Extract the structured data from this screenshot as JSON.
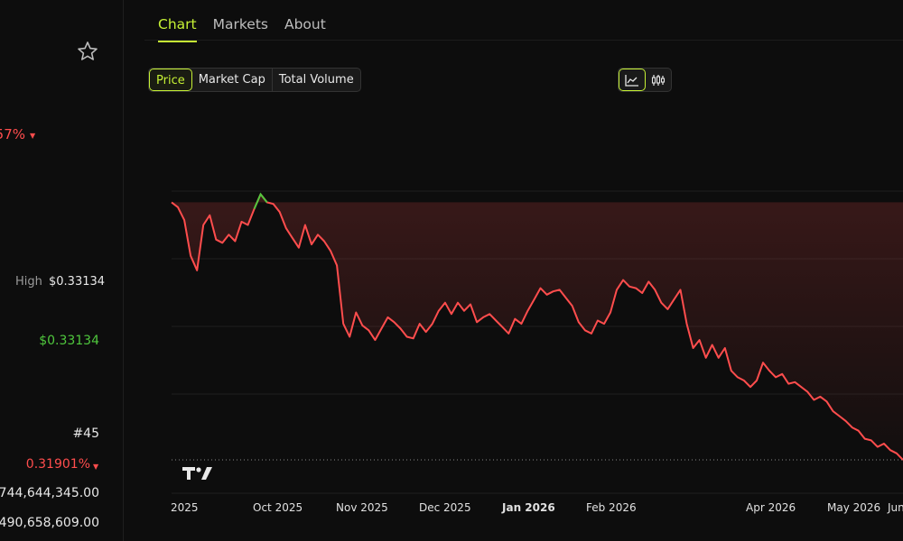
{
  "left_panel": {
    "change_pct": "57%",
    "high_label": "High",
    "high_value": "$0.33134",
    "green_value": "$0.33134",
    "rank": "#45",
    "red_pct": "0.31901%",
    "big_num_1": "744,644,345.00",
    "big_num_2": "490,658,609.00"
  },
  "tabs": [
    {
      "label": "Chart",
      "active": true
    },
    {
      "label": "Markets",
      "active": false
    },
    {
      "label": "About",
      "active": false
    }
  ],
  "metric_tabs": {
    "price": "Price",
    "market_cap": "Market Cap",
    "total_volume": "Total Volume",
    "active": "price"
  },
  "chart_toggle": {
    "line_icon": "line-chart-icon",
    "candle_icon": "candlestick-icon",
    "active": "line"
  },
  "colors": {
    "accent": "#c6f135",
    "down": "#ff4d4d",
    "up": "#4fc73d",
    "bg": "#0d0d0d"
  },
  "chart_data": {
    "type": "line",
    "title": "",
    "xlabel": "",
    "ylabel": "",
    "x_tick_labels": [
      "2025",
      "Oct 2025",
      "Nov 2025",
      "Dec 2025",
      "Jan 2026",
      "Feb 2026",
      "Apr 2026",
      "May 2026",
      "Jun"
    ],
    "x_tick_bold": [
      false,
      false,
      false,
      false,
      true,
      false,
      false,
      false,
      false
    ],
    "y_axis_visible": false,
    "grid": "horizontal",
    "reference_line": "dotted at lowest price",
    "series": [
      {
        "values": [
          0.3,
          0.297,
          0.289,
          0.267,
          0.258,
          0.286,
          0.292,
          0.277,
          0.275,
          0.28,
          0.276,
          0.288,
          0.286,
          0.296,
          0.305,
          0.3,
          0.299,
          0.294,
          0.284,
          0.278,
          0.272,
          0.286,
          0.274,
          0.28,
          0.276,
          0.27,
          0.261,
          0.225,
          0.217,
          0.232,
          0.224,
          0.221,
          0.215,
          0.222,
          0.229,
          0.226,
          0.222,
          0.217,
          0.216,
          0.225,
          0.22,
          0.225,
          0.233,
          0.238,
          0.231,
          0.238,
          0.233,
          0.237,
          0.226,
          0.229,
          0.231,
          0.227,
          0.223,
          0.219,
          0.228,
          0.225,
          0.233,
          0.24,
          0.247,
          0.243,
          0.245,
          0.246,
          0.241,
          0.236,
          0.226,
          0.221,
          0.219,
          0.227,
          0.225,
          0.232,
          0.246,
          0.252,
          0.248,
          0.247,
          0.244,
          0.251,
          0.246,
          0.238,
          0.234,
          0.24,
          0.246,
          0.225,
          0.21,
          0.215,
          0.204,
          0.212,
          0.204,
          0.21,
          0.196,
          0.192,
          0.19,
          0.186,
          0.19,
          0.201,
          0.196,
          0.192,
          0.194,
          0.188,
          0.189,
          0.186,
          0.183,
          0.178,
          0.18,
          0.177,
          0.171,
          0.168,
          0.165,
          0.161,
          0.159,
          0.154,
          0.153,
          0.149,
          0.151,
          0.147,
          0.145,
          0.141
        ]
      }
    ],
    "max_point_color": "#4fc73d",
    "line_color": "#ff4d4d"
  }
}
